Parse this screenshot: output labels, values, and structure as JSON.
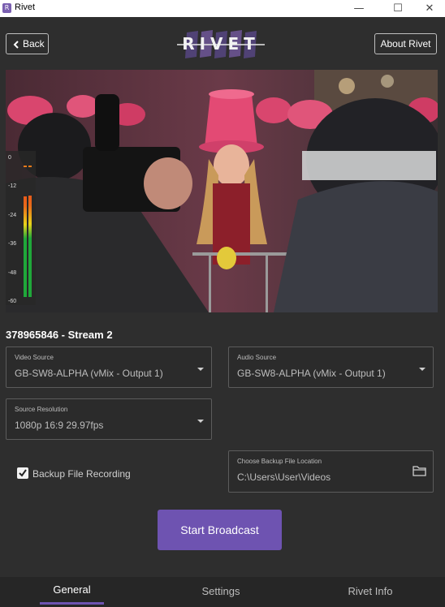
{
  "window": {
    "title": "Rivet",
    "app_icon": "R",
    "minimize_glyph": "—",
    "maximize_glyph": "☐",
    "close_glyph": "✕"
  },
  "header": {
    "back_label": "Back",
    "back_icon": "chevron-left-icon",
    "logo_text": "RIVET",
    "about_label": "About Rivet"
  },
  "meter": {
    "ticks": [
      "0",
      "-12",
      "-24",
      "-36",
      "-48",
      "-60"
    ],
    "left_level": 0.75,
    "right_level": 0.76
  },
  "stream": {
    "label": "378965846 - Stream 2"
  },
  "video_source": {
    "label": "Video Source",
    "value": "GB-SW8-ALPHA (vMix - Output 1)"
  },
  "audio_source": {
    "label": "Audio Source",
    "value": "GB-SW8-ALPHA (vMix - Output 1)"
  },
  "source_resolution": {
    "label": "Source Resolution",
    "value": "1080p 16:9 29.97fps"
  },
  "backup": {
    "checkbox_label": "Backup File Recording",
    "checked": true,
    "location_label": "Choose Backup File Location",
    "location_value": "C:\\Users\\User\\Videos",
    "folder_icon": "folder-icon"
  },
  "start_broadcast_label": "Start Broadcast",
  "tabs": [
    {
      "label": "General",
      "active": true
    },
    {
      "label": "Settings",
      "active": false
    },
    {
      "label": "Rivet Info",
      "active": false
    }
  ],
  "colors": {
    "accent": "#6e53b1",
    "background": "#2e2e2e",
    "meter_green": "#1fa83a",
    "meter_orange": "#e86a1a"
  }
}
